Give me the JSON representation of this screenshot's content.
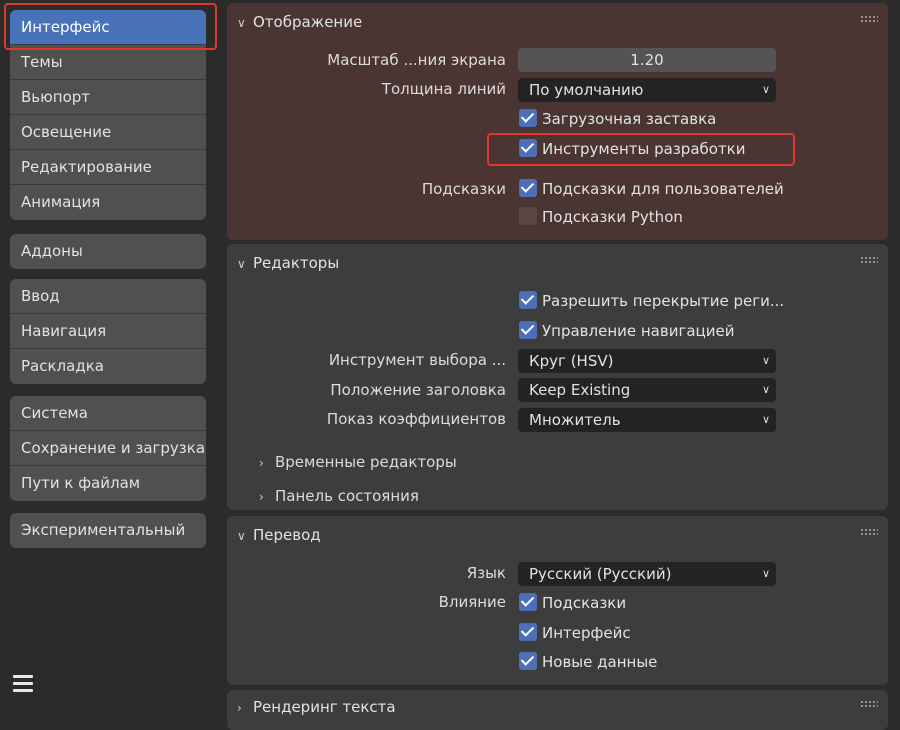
{
  "sidebar": {
    "group1": [
      "Интерфейс",
      "Темы",
      "Вьюпорт",
      "Освещение",
      "Редактирование",
      "Анимация"
    ],
    "group2": [
      "Аддоны"
    ],
    "group3": [
      "Ввод",
      "Навигация",
      "Раскладка"
    ],
    "group4": [
      "Система",
      "Сохранение и загрузка",
      "Пути к файлам"
    ],
    "group5": [
      "Экспериментальный"
    ]
  },
  "display": {
    "title": "Отображение",
    "scale_label": "Масштаб ...ния экрана",
    "scale_value": "1.20",
    "line_label": "Толщина линий",
    "line_value": "По умолчанию",
    "splash": "Загрузочная заставка",
    "devtools": "Инструменты разработки",
    "tooltips_label": "Подсказки",
    "user_tooltips": "Подсказки для пользователей",
    "python_tooltips": "Подсказки Python"
  },
  "editors": {
    "title": "Редакторы",
    "region_overlap": "Разрешить перекрытие реги...",
    "nav_controls": "Управление навигацией",
    "color_picker_label": "Инструмент выбора ...",
    "color_picker_value": "Круг (HSV)",
    "header_pos_label": "Положение заголовка",
    "header_pos_value": "Keep Existing",
    "factor_label": "Показ коэффициентов",
    "factor_value": "Множитель",
    "temporal": "Временные редакторы",
    "status_bar": "Панель состояния"
  },
  "translation": {
    "title": "Перевод",
    "lang_label": "Язык",
    "lang_value": "Русский (Русский)",
    "affect_label": "Влияние",
    "tooltips": "Подсказки",
    "interface": "Интерфейс",
    "new_data": "Новые данные"
  },
  "text_render": {
    "title": "Рендеринг текста"
  },
  "colors": {
    "accent": "#4873b8",
    "highlight": "#e0362e"
  }
}
